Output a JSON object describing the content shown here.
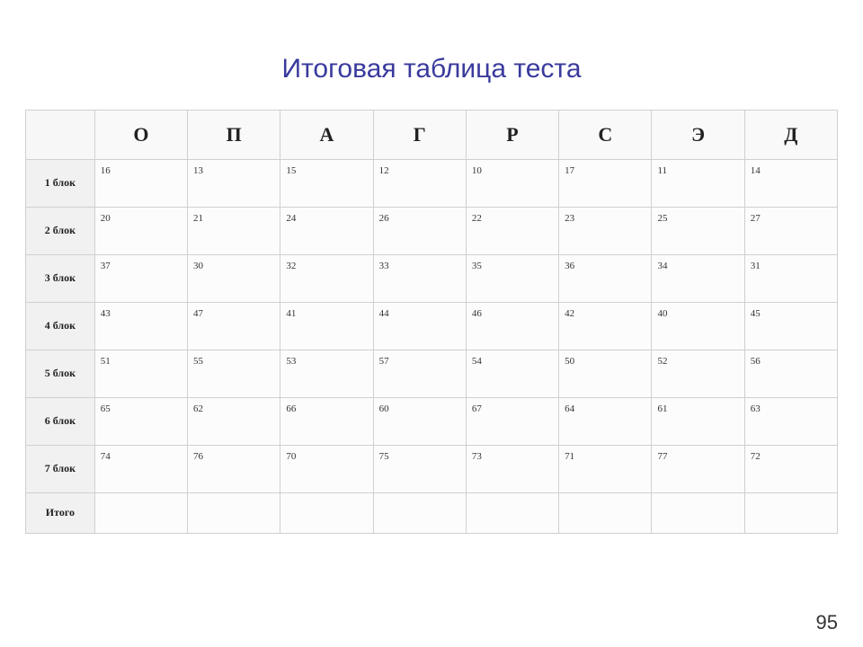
{
  "title": "Итоговая таблица теста",
  "page_number": "95",
  "columns": [
    "О",
    "П",
    "А",
    "Г",
    "Р",
    "С",
    "Э",
    "Д"
  ],
  "rows": [
    {
      "label": "1 блок",
      "values": [
        "16",
        "13",
        "15",
        "12",
        "10",
        "17",
        "11",
        "14"
      ]
    },
    {
      "label": "2 блок",
      "values": [
        "20",
        "21",
        "24",
        "26",
        "22",
        "23",
        "25",
        "27"
      ]
    },
    {
      "label": "3 блок",
      "values": [
        "37",
        "30",
        "32",
        "33",
        "35",
        "36",
        "34",
        "31"
      ]
    },
    {
      "label": "4 блок",
      "values": [
        "43",
        "47",
        "41",
        "44",
        "46",
        "42",
        "40",
        "45"
      ]
    },
    {
      "label": "5 блок",
      "values": [
        "51",
        "55",
        "53",
        "57",
        "54",
        "50",
        "52",
        "56"
      ]
    },
    {
      "label": "6 блок",
      "values": [
        "65",
        "62",
        "66",
        "60",
        "67",
        "64",
        "61",
        "63"
      ]
    },
    {
      "label": "7 блок",
      "values": [
        "74",
        "76",
        "70",
        "75",
        "73",
        "71",
        "77",
        "72"
      ]
    },
    {
      "label": "Итого",
      "values": [
        "",
        "",
        "",
        "",
        "",
        "",
        "",
        ""
      ]
    }
  ],
  "chart_data": {
    "type": "table",
    "title": "Итоговая таблица теста",
    "columns": [
      "О",
      "П",
      "А",
      "Г",
      "Р",
      "С",
      "Э",
      "Д"
    ],
    "rows": [
      {
        "label": "1 блок",
        "values": [
          16,
          13,
          15,
          12,
          10,
          17,
          11,
          14
        ]
      },
      {
        "label": "2 блок",
        "values": [
          20,
          21,
          24,
          26,
          22,
          23,
          25,
          27
        ]
      },
      {
        "label": "3 блок",
        "values": [
          37,
          30,
          32,
          33,
          35,
          36,
          34,
          31
        ]
      },
      {
        "label": "4 блок",
        "values": [
          43,
          47,
          41,
          44,
          46,
          42,
          40,
          45
        ]
      },
      {
        "label": "5 блок",
        "values": [
          51,
          55,
          53,
          57,
          54,
          50,
          52,
          56
        ]
      },
      {
        "label": "6 блок",
        "values": [
          65,
          62,
          66,
          60,
          67,
          64,
          61,
          63
        ]
      },
      {
        "label": "7 блок",
        "values": [
          74,
          76,
          70,
          75,
          73,
          71,
          77,
          72
        ]
      },
      {
        "label": "Итого",
        "values": [
          null,
          null,
          null,
          null,
          null,
          null,
          null,
          null
        ]
      }
    ]
  }
}
